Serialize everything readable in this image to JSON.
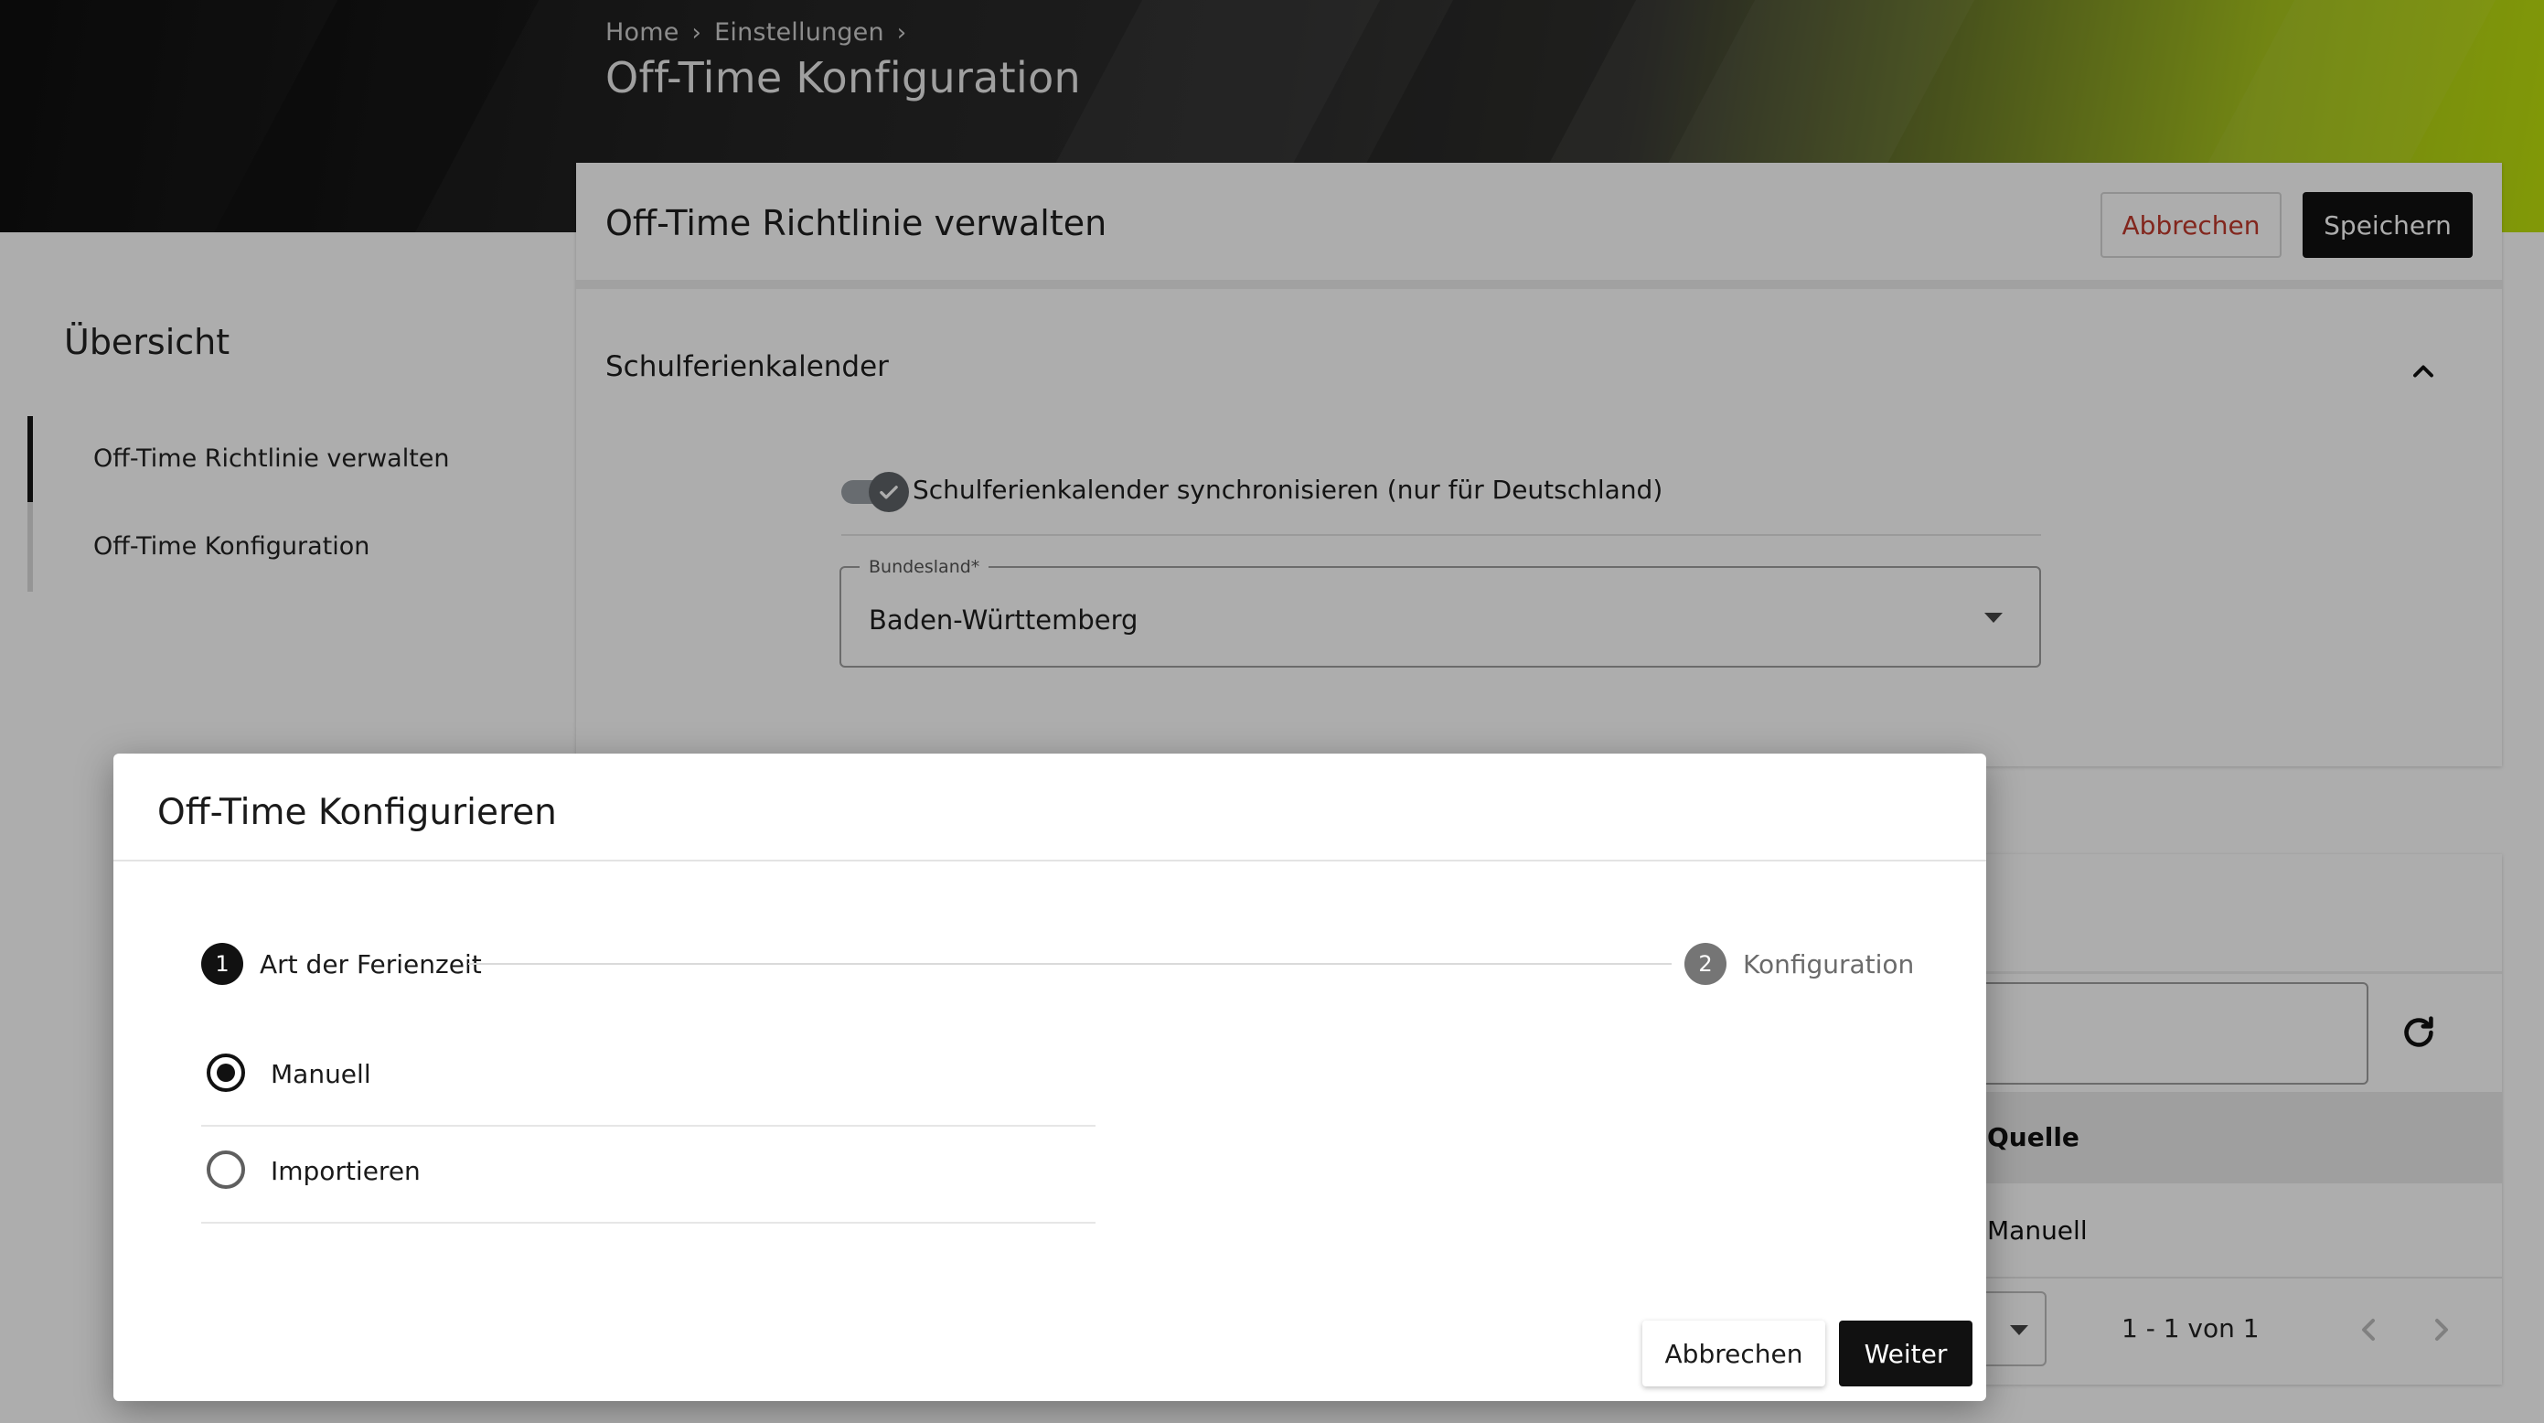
{
  "header": {
    "breadcrumb": [
      "Home",
      "Einstellungen"
    ],
    "title": "Off-Time Konfiguration"
  },
  "sidebar": {
    "title": "Übersicht",
    "items": [
      {
        "label": "Off-Time Richtlinie verwalten",
        "active": true
      },
      {
        "label": "Off-Time Konfiguration",
        "active": false
      }
    ]
  },
  "main": {
    "title": "Off-Time Richtlinie verwalten",
    "cancel_label": "Abbrechen",
    "save_label": "Speichern",
    "section": {
      "title": "Schulferienkalender",
      "toggle_label": "Schulferienkalender synchronisieren (nur für Deutschland)",
      "toggle_on": true,
      "select_label": "Bundesland*",
      "select_value": "Baden-Württemberg"
    }
  },
  "table": {
    "column_header": "Quelle",
    "cell_value": "Manuell",
    "pagination": "1 - 1 von 1"
  },
  "dialog": {
    "title": "Off-Time Konfigurieren",
    "steps": [
      {
        "number": "1",
        "label": "Art der Ferienzeit",
        "active": true
      },
      {
        "number": "2",
        "label": "Konfiguration",
        "active": false
      }
    ],
    "options": [
      {
        "label": "Manuell",
        "selected": true
      },
      {
        "label": "Importieren",
        "selected": false
      }
    ],
    "cancel_label": "Abbrechen",
    "next_label": "Weiter"
  },
  "colors": {
    "primary": "#111111",
    "danger_text": "#c0392b",
    "accent_green": "#bfe20c"
  },
  "icons": [
    "chevron-right-icon",
    "chevron-up-icon",
    "check-icon",
    "caret-down-icon",
    "refresh-icon",
    "chevron-left-icon"
  ]
}
